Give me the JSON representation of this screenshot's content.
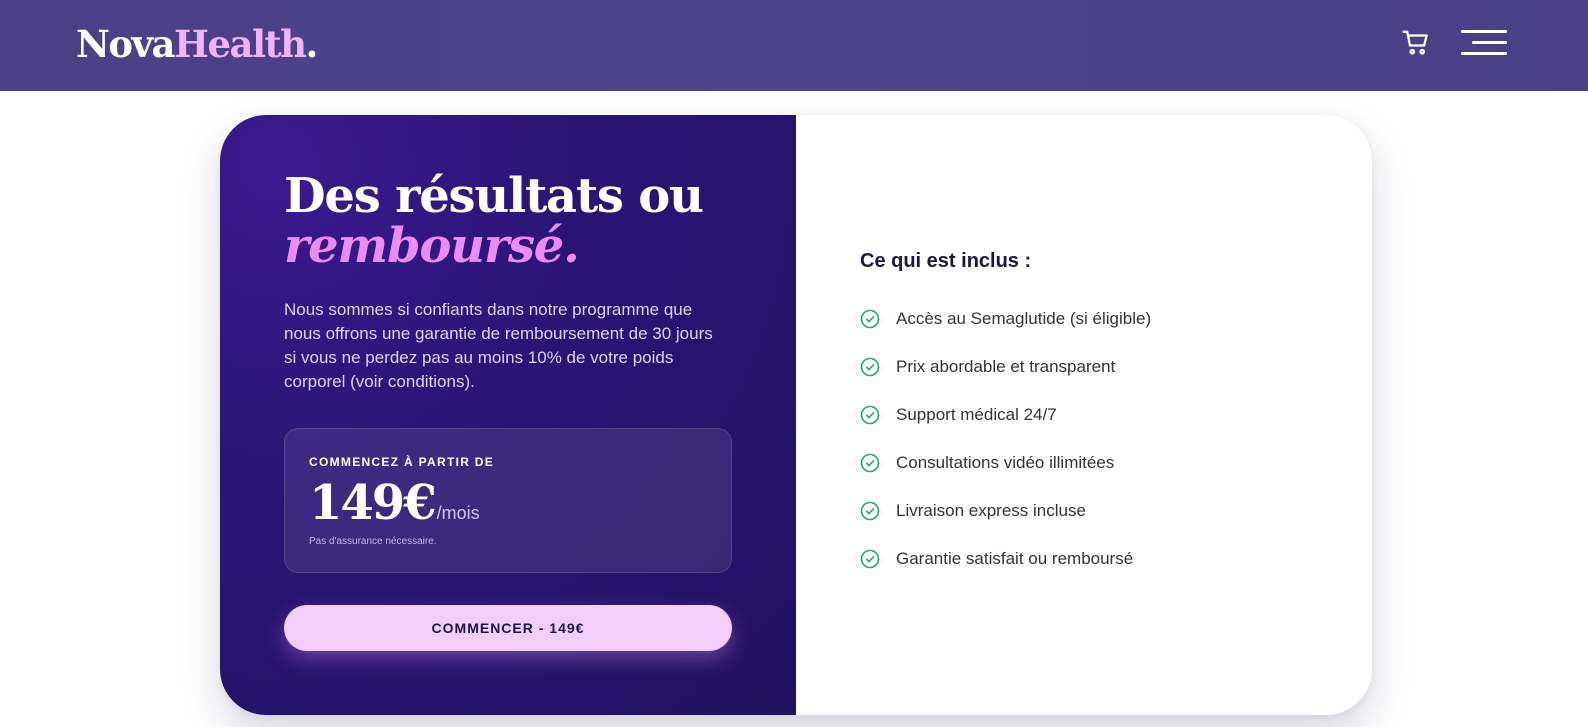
{
  "header": {
    "logo_part1": "Nova",
    "logo_part2": "Health",
    "logo_dot": ".",
    "cart_icon": "cart-icon",
    "menu_icon": "hamburger-menu-icon",
    "background_color": "#4b3f86"
  },
  "offer": {
    "title_line1": "Des résultats ou",
    "title_line2": "remboursé.",
    "description": "Nous sommes si confiants dans notre programme que nous offrons une garantie de remboursement de 30 jours si vous ne perdez pas au moins 10% de votre poids corporel (voir conditions).",
    "price_label": "COMMENCEZ À PARTIR DE",
    "price_amount": "149€",
    "price_period": "/mois",
    "price_note": "Pas d'assurance nécessaire.",
    "cta_label": "COMMENCER - 149€",
    "accent_color": "#ea8cf2",
    "cta_color": "#f4cefb"
  },
  "included": {
    "title": "Ce qui est inclus :",
    "items": [
      {
        "label": "Accès au Semaglutide (si éligible)",
        "icon": "check-circle-icon"
      },
      {
        "label": "Prix abordable et transparent",
        "icon": "check-circle-icon"
      },
      {
        "label": "Support médical 24/7",
        "icon": "check-circle-icon"
      },
      {
        "label": "Consultations vidéo illimitées",
        "icon": "check-circle-icon"
      },
      {
        "label": "Livraison express incluse",
        "icon": "check-circle-icon"
      },
      {
        "label": "Garantie satisfait ou remboursé",
        "icon": "check-circle-icon"
      }
    ],
    "check_color": "#22a86b"
  }
}
